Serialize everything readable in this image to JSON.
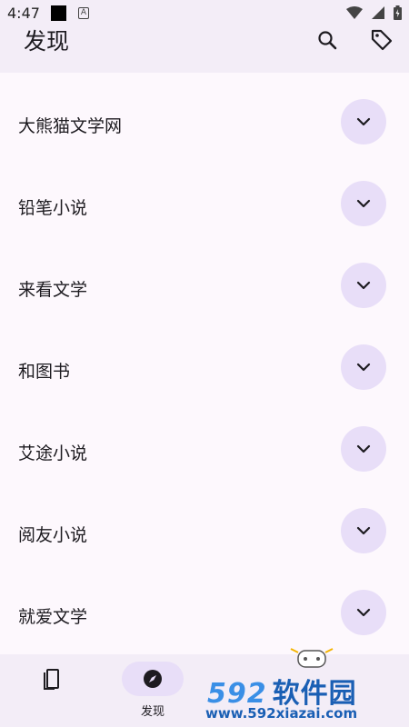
{
  "status_bar": {
    "time": "4:47"
  },
  "app_bar": {
    "title": "发现",
    "actions": [
      {
        "name": "search",
        "icon": "search-icon"
      },
      {
        "name": "tag",
        "icon": "tag-icon"
      }
    ]
  },
  "sources": [
    {
      "label": "大熊猫文学网"
    },
    {
      "label": "铅笔小说"
    },
    {
      "label": "来看文学"
    },
    {
      "label": "和图书"
    },
    {
      "label": "艾途小说"
    },
    {
      "label": "阅友小说"
    },
    {
      "label": "就爱文学"
    }
  ],
  "bottom_nav": {
    "items": [
      {
        "label": "",
        "icon": "bookshelf-icon",
        "active": false
      },
      {
        "label": "发现",
        "icon": "compass-icon",
        "active": true
      }
    ]
  },
  "watermark": {
    "number": "592",
    "brand": "软件园",
    "url": "www.592xiazai.com"
  },
  "colors": {
    "background": "#fdf8fd",
    "bar": "#f3edf7",
    "accent_container": "#e8def8"
  }
}
